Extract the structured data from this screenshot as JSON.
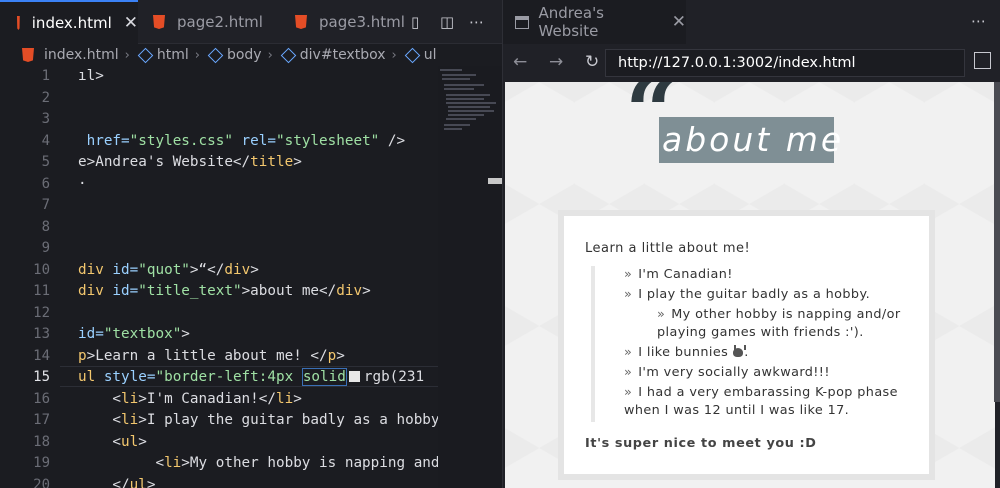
{
  "editor": {
    "tabs": [
      {
        "label": "index.html",
        "active": true,
        "close": "✕"
      },
      {
        "label": "page2.html"
      },
      {
        "label": "page3.html"
      }
    ],
    "toolbar_more": "⋯",
    "breadcrumb": [
      "index.html",
      "html",
      "body",
      "div#textbox",
      "ul"
    ],
    "current_line": 15,
    "lines": [
      {
        "n": 1,
        "frag": [
          [
            "t",
            "ıl>"
          ]
        ]
      },
      {
        "n": 2,
        "frag": []
      },
      {
        "n": 3,
        "frag": []
      },
      {
        "n": 4,
        "frag": [
          [
            "a",
            " href="
          ],
          [
            "s",
            "\"styles.css\""
          ],
          [
            "a",
            " rel="
          ],
          [
            "s",
            "\"stylesheet\""
          ],
          [
            "t",
            " />"
          ]
        ]
      },
      {
        "n": 5,
        "frag": [
          [
            "t",
            "e>Andrea's Website</"
          ],
          [
            "k",
            "title"
          ],
          [
            "t",
            ">"
          ]
        ]
      },
      {
        "n": 6,
        "frag": [
          [
            "t",
            "·"
          ]
        ]
      },
      {
        "n": 7,
        "frag": []
      },
      {
        "n": 8,
        "frag": []
      },
      {
        "n": 9,
        "frag": []
      },
      {
        "n": 10,
        "frag": [
          [
            "k",
            "div"
          ],
          [
            "a",
            " id="
          ],
          [
            "s",
            "\"quot\""
          ],
          [
            "t",
            ">“</"
          ],
          [
            "k",
            "div"
          ],
          [
            "t",
            ">"
          ]
        ]
      },
      {
        "n": 11,
        "frag": [
          [
            "k",
            "div"
          ],
          [
            "a",
            " id="
          ],
          [
            "s",
            "\"title_text\""
          ],
          [
            "t",
            ">about me</"
          ],
          [
            "k",
            "div"
          ],
          [
            "t",
            ">"
          ]
        ]
      },
      {
        "n": 12,
        "frag": []
      },
      {
        "n": 13,
        "frag": [
          [
            "a",
            "id="
          ],
          [
            "s",
            "\"textbox\""
          ],
          [
            "t",
            ">"
          ]
        ]
      },
      {
        "n": 14,
        "frag": [
          [
            "k",
            "p"
          ],
          [
            "t",
            ">Learn a little about me! </"
          ],
          [
            "k",
            "p"
          ],
          [
            "t",
            ">"
          ]
        ]
      },
      {
        "n": 15,
        "frag": [
          [
            "k",
            "ul"
          ],
          [
            "a",
            " style="
          ],
          [
            "s",
            "\"border-left:4px "
          ],
          [
            "sel",
            "solid"
          ],
          [
            "sw",
            ""
          ],
          [
            "t",
            "rgb(231"
          ]
        ]
      },
      {
        "n": 16,
        "frag": [
          [
            "t",
            "    <"
          ],
          [
            "k",
            "li"
          ],
          [
            "t",
            ">I'm Canadian!</"
          ],
          [
            "k",
            "li"
          ],
          [
            "t",
            ">"
          ]
        ]
      },
      {
        "n": 17,
        "frag": [
          [
            "t",
            "    <"
          ],
          [
            "k",
            "li"
          ],
          [
            "t",
            ">I play the guitar badly as a hobby"
          ]
        ]
      },
      {
        "n": 18,
        "frag": [
          [
            "t",
            "    <"
          ],
          [
            "k",
            "ul"
          ],
          [
            "t",
            ">"
          ]
        ]
      },
      {
        "n": 19,
        "frag": [
          [
            "t",
            "         <"
          ],
          [
            "k",
            "li"
          ],
          [
            "t",
            ">My other hobby is napping and/"
          ]
        ]
      },
      {
        "n": 20,
        "frag": [
          [
            "t",
            "    </"
          ],
          [
            "k",
            "ul"
          ],
          [
            "t",
            ">"
          ]
        ]
      }
    ]
  },
  "browser": {
    "tab_title": "Andrea's Website",
    "close": "✕",
    "more": "⋯",
    "url": "http://127.0.0.1:3002/index.html",
    "page": {
      "quote": "“",
      "title": "about me",
      "lead": "Learn a little about me!",
      "bullet": "»",
      "items": [
        {
          "text": "I'm Canadian!",
          "sub": false
        },
        {
          "text": "I play the guitar badly as a hobby.",
          "sub": false
        },
        {
          "text": "My other hobby is napping and/or playing games with friends :').",
          "sub": true
        },
        {
          "text": "I like bunnies",
          "sub": false,
          "bunny": true,
          "after": "."
        },
        {
          "text": "I'm very socially awkward!!!",
          "sub": false
        },
        {
          "text": "I had a very embarassing K-pop phase when I was 12 until I was like 17.",
          "sub": false
        }
      ],
      "footer": "It's super nice to meet you :D"
    }
  }
}
